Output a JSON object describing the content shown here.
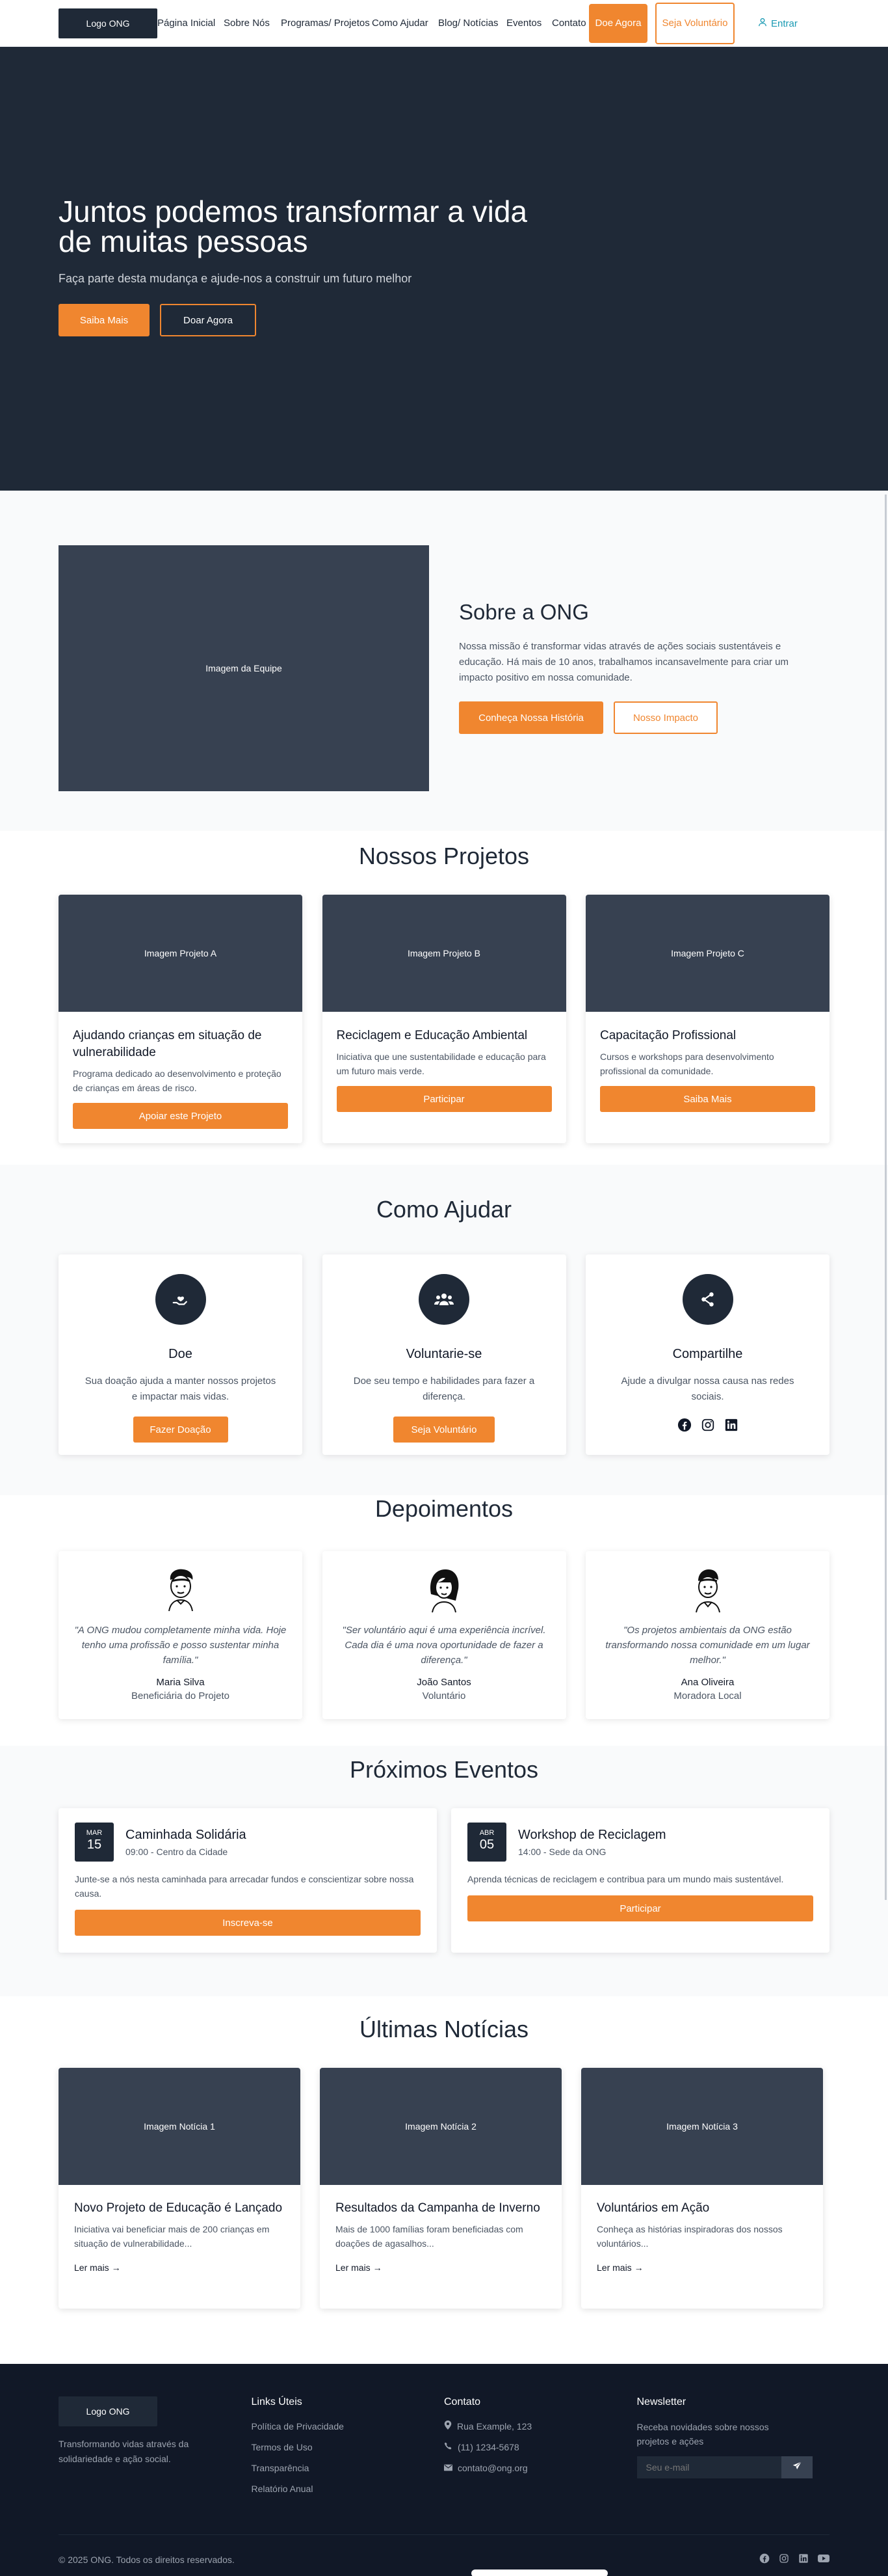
{
  "nav": {
    "logo": "Logo ONG",
    "items": [
      "Página Inicial",
      "Sobre Nós",
      "Programas/ Projetos",
      "Como Ajudar",
      "Blog/ Notícias",
      "Eventos",
      "Contato"
    ],
    "donate": "Doe Agora",
    "volunteer": "Seja Voluntário",
    "login": "Entrar"
  },
  "hero": {
    "title": "Juntos podemos transformar a vida de muitas pessoas",
    "subtitle": "Faça parte desta mudança e ajude-nos a construir um futuro melhor",
    "btn_more": "Saiba Mais",
    "btn_donate": "Doar Agora"
  },
  "about": {
    "image": "Imagem da Equipe",
    "title": "Sobre a ONG",
    "text": "Nossa missão é transformar vidas através de ações sociais sustentáveis e educação. Há mais de 10 anos, trabalhamos incansavelmente para criar um impacto positivo em nossa comunidade.",
    "btn_history": "Conheça Nossa História",
    "btn_impact": "Nosso Impacto"
  },
  "projects": {
    "title": "Nossos Projetos",
    "items": [
      {
        "image": "Imagem Projeto A",
        "title": "Ajudando crianças em situação de vulnerabilidade",
        "text": "Programa dedicado ao desenvolvimento e proteção de crianças em áreas de risco.",
        "button": "Apoiar este Projeto"
      },
      {
        "image": "Imagem Projeto B",
        "title": "Reciclagem e Educação Ambiental",
        "text": "Iniciativa que une sustentabilidade e educação para um futuro mais verde.",
        "button": "Participar"
      },
      {
        "image": "Imagem Projeto C",
        "title": "Capacitação Profissional",
        "text": "Cursos e workshops para desenvolvimento profissional da comunidade.",
        "button": "Saiba Mais"
      }
    ]
  },
  "help": {
    "title": "Como Ajudar",
    "items": [
      {
        "icon": "hand-heart-icon",
        "title": "Doe",
        "text": "Sua doação ajuda a manter nossos projetos e impactar mais vidas.",
        "button": "Fazer Doação"
      },
      {
        "icon": "users-icon",
        "title": "Voluntarie-se",
        "text": "Doe seu tempo e habilidades para fazer a diferença.",
        "button": "Seja Voluntário"
      },
      {
        "icon": "share-icon",
        "title": "Compartilhe",
        "text": "Ajude a divulgar nossa causa nas redes sociais."
      }
    ]
  },
  "testimonials": {
    "title": "Depoimentos",
    "items": [
      {
        "quote": "\"A ONG mudou completamente minha vida. Hoje tenho uma profissão e posso sustentar minha família.\"",
        "name": "Maria Silva",
        "role": "Beneficiária do Projeto"
      },
      {
        "quote": "\"Ser voluntário aqui é uma experiência incrível. Cada dia é uma nova oportunidade de fazer a diferença.\"",
        "name": "João Santos",
        "role": "Voluntário"
      },
      {
        "quote": "\"Os projetos ambientais da ONG estão transformando nossa comunidade em um lugar melhor.\"",
        "name": "Ana Oliveira",
        "role": "Moradora Local"
      }
    ]
  },
  "events": {
    "title": "Próximos Eventos",
    "items": [
      {
        "month": "MAR",
        "day": "15",
        "title": "Caminhada Solidária",
        "meta": "09:00 - Centro da Cidade",
        "text": "Junte-se a nós nesta caminhada para arrecadar fundos e conscientizar sobre nossa causa.",
        "button": "Inscreva-se"
      },
      {
        "month": "ABR",
        "day": "05",
        "title": "Workshop de Reciclagem",
        "meta": "14:00 - Sede da ONG",
        "text": "Aprenda técnicas de reciclagem e contribua para um mundo mais sustentável.",
        "button": "Participar"
      }
    ]
  },
  "news": {
    "title": "Últimas Notícias",
    "items": [
      {
        "image": "Imagem Notícia 1",
        "title": "Novo Projeto de Educação é Lançado",
        "text": "Iniciativa vai beneficiar mais de 200 crianças em situação de vulnerabilidade...",
        "more": "Ler mais →"
      },
      {
        "image": "Imagem Notícia 2",
        "title": "Resultados da Campanha de Inverno",
        "text": "Mais de 1000 famílias foram beneficiadas com doações de agasalhos...",
        "more": "Ler mais →"
      },
      {
        "image": "Imagem Notícia 3",
        "title": "Voluntários em Ação",
        "text": "Conheça as histórias inspiradoras dos nossos voluntários...",
        "more": "Ler mais →"
      }
    ]
  },
  "footer": {
    "logo": "Logo ONG",
    "desc": "Transformando vidas através da solidariedade e ação social.",
    "links_title": "Links Úteis",
    "links": [
      "Política de Privacidade",
      "Termos de Uso",
      "Transparência",
      "Relatório Anual"
    ],
    "contact_title": "Contato",
    "address": "Rua Example, 123",
    "phone": "(11) 1234-5678",
    "email": "contato@ong.org",
    "newsletter_title": "Newsletter",
    "newsletter_text": "Receba novidades sobre nossos projetos e ações",
    "newsletter_placeholder": "Seu e-mail",
    "copyright": "© 2025 ONG. Todos os direitos reservados."
  },
  "colors": {
    "accent": "#f0862f",
    "dark": "#1f2937",
    "footer": "#111827",
    "link": "#1a9ab3"
  }
}
